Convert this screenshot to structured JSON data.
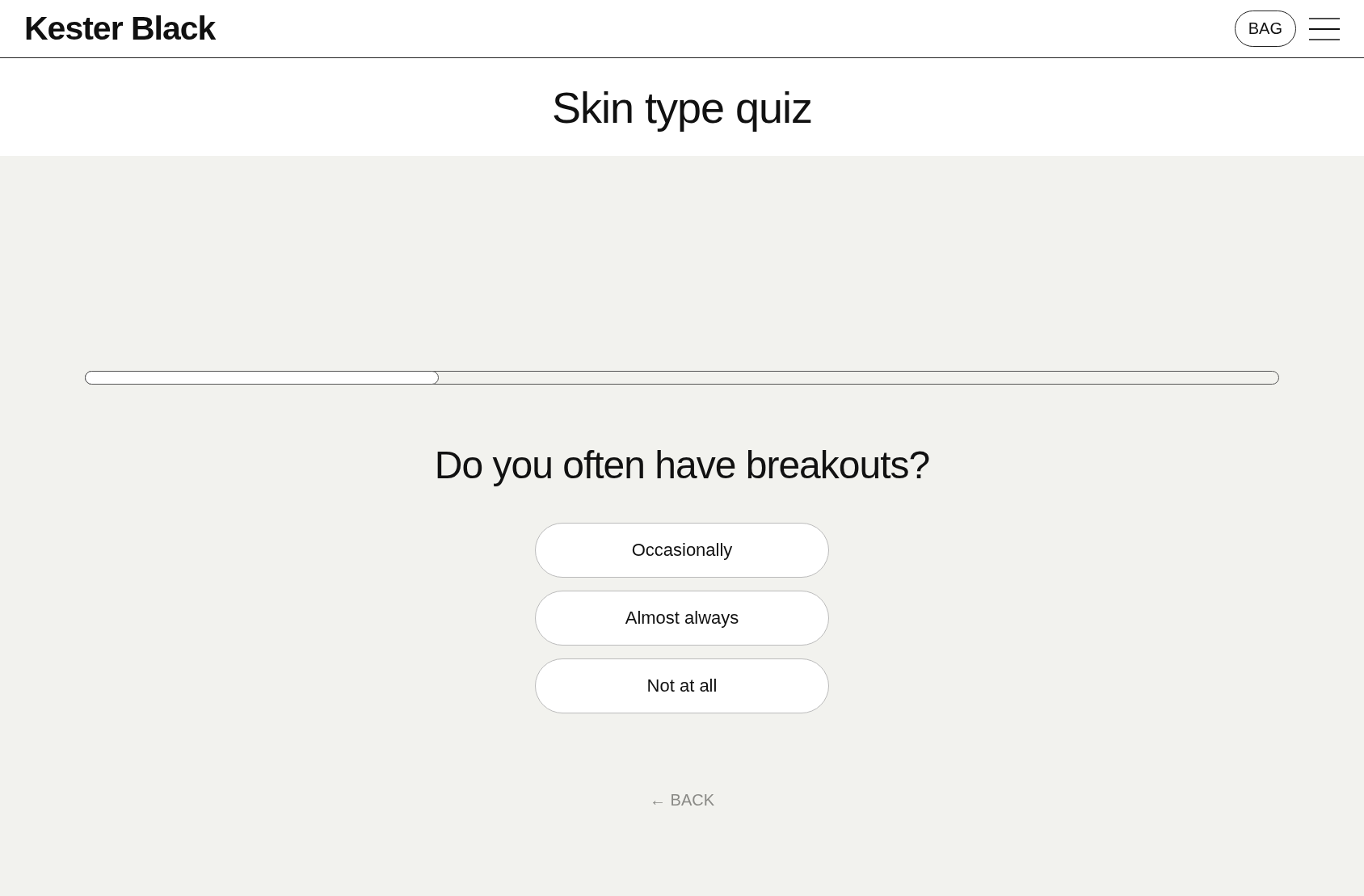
{
  "header": {
    "logo": "Kester Black",
    "bag": "BAG"
  },
  "title": "Skin type quiz",
  "progress": {
    "level": 0.297
  },
  "question": "Do you often have breakouts?",
  "answers": [
    {
      "label": "Occasionally"
    },
    {
      "label": "Almost always"
    },
    {
      "label": "Not at all"
    }
  ],
  "back": "← BACK"
}
